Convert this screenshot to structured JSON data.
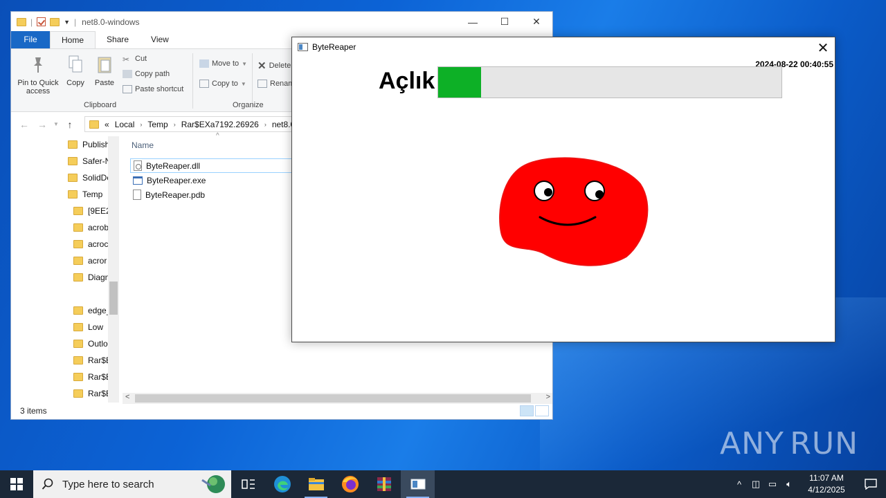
{
  "explorer": {
    "title": "net8.0-windows",
    "tabs": [
      "File",
      "Home",
      "Share",
      "View"
    ],
    "ribbon": {
      "pin_label_1": "Pin to Quick",
      "pin_label_2": "access",
      "copy_label": "Copy",
      "paste_label": "Paste",
      "cut_label": "Cut",
      "copy_path_label": "Copy path",
      "paste_shortcut_label": "Paste shortcut",
      "clipboard_group": "Clipboard",
      "move_to_label": "Move to",
      "copy_to_label": "Copy to",
      "delete_label": "Delete",
      "rename_label": "Renam",
      "organize_group": "Organize"
    },
    "address": {
      "prefix": "«",
      "crumbs": [
        "Local",
        "Temp",
        "Rar$EXa7192.26926",
        "net8.0-"
      ]
    },
    "nav_items": [
      "Publish",
      "Safer-N",
      "SolidDc",
      "Temp",
      "[9EE29",
      "acrob",
      "acroc",
      "acror",
      "Diagn",
      "edge_",
      "Low",
      "Outlo",
      "Rar$E:",
      "Rar$E:",
      "Rar$E:"
    ],
    "column_name": "Name",
    "files": [
      {
        "name": "ByteReaper.dll",
        "type": "dll"
      },
      {
        "name": "ByteReaper.exe",
        "type": "exe"
      },
      {
        "name": "ByteReaper.pdb",
        "type": "pdb"
      }
    ],
    "status": "3 items"
  },
  "app": {
    "title": "ByteReaper",
    "timestamp": "2024-08-22 00:40:55",
    "hunger_label": "Açlık",
    "hunger_fraction": 0.124,
    "fill_color": "#0db026",
    "creature_color": "#ff0000"
  },
  "taskbar": {
    "search_placeholder": "Type here to search",
    "time": "11:07 AM",
    "date": "4/12/2025"
  },
  "watermark": {
    "left": "ANY",
    "right": "RUN"
  }
}
